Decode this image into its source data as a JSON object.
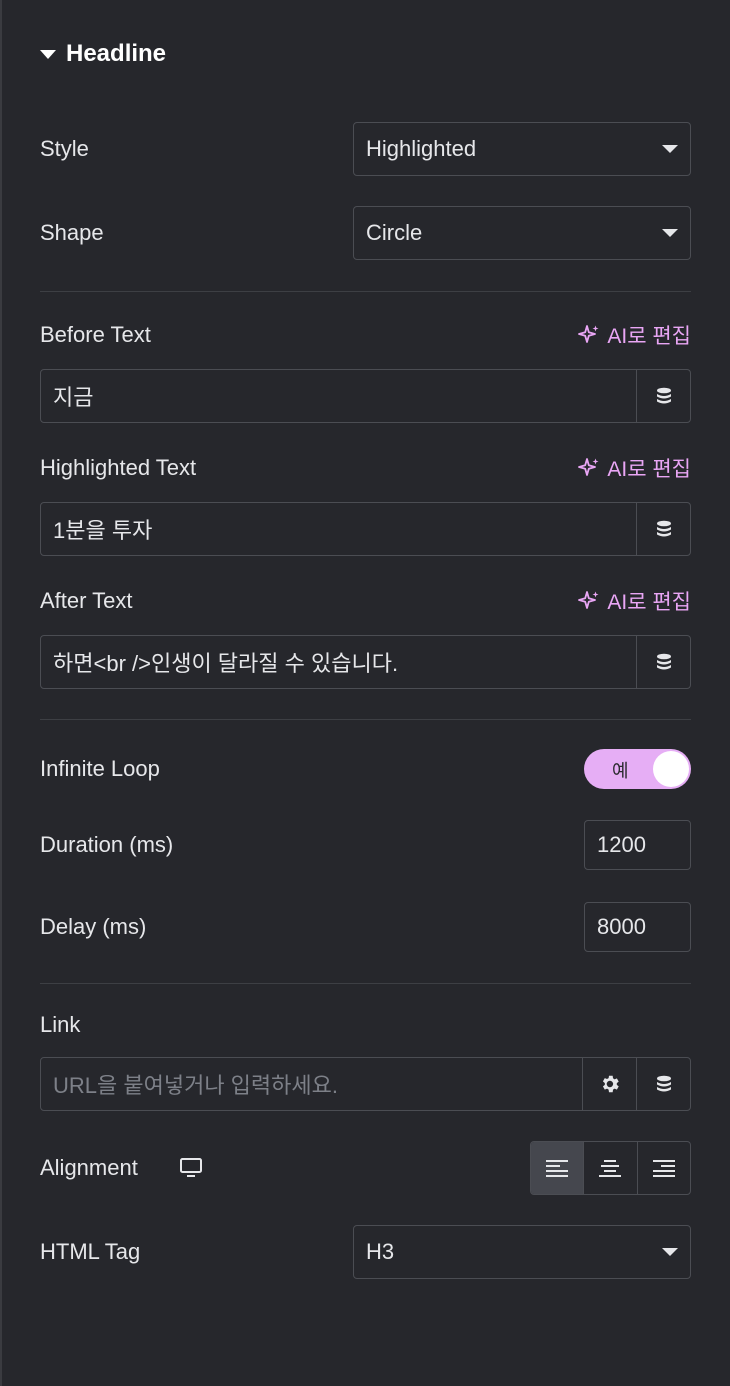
{
  "section": {
    "title": "Headline"
  },
  "style": {
    "label": "Style",
    "value": "Highlighted"
  },
  "shape": {
    "label": "Shape",
    "value": "Circle"
  },
  "ai_edit_label": "AI로 편집",
  "before_text": {
    "label": "Before Text",
    "value": "지금"
  },
  "highlighted_text": {
    "label": "Highlighted Text",
    "value": "1분을 투자"
  },
  "after_text": {
    "label": "After Text",
    "value": "하면<br />인생이 달라질 수 있습니다."
  },
  "infinite_loop": {
    "label": "Infinite Loop",
    "toggle_text": "예",
    "on": true
  },
  "duration": {
    "label": "Duration (ms)",
    "value": "1200"
  },
  "delay": {
    "label": "Delay (ms)",
    "value": "8000"
  },
  "link": {
    "label": "Link",
    "placeholder": "URL을 붙여넣거나 입력하세요."
  },
  "alignment": {
    "label": "Alignment",
    "options": [
      "left",
      "center",
      "right"
    ],
    "selected": "left"
  },
  "html_tag": {
    "label": "HTML Tag",
    "value": "H3"
  },
  "colors": {
    "background": "#26272c",
    "accent": "#e9a6f5",
    "toggle_bg": "#e6aef5",
    "border": "#4b4d53"
  }
}
